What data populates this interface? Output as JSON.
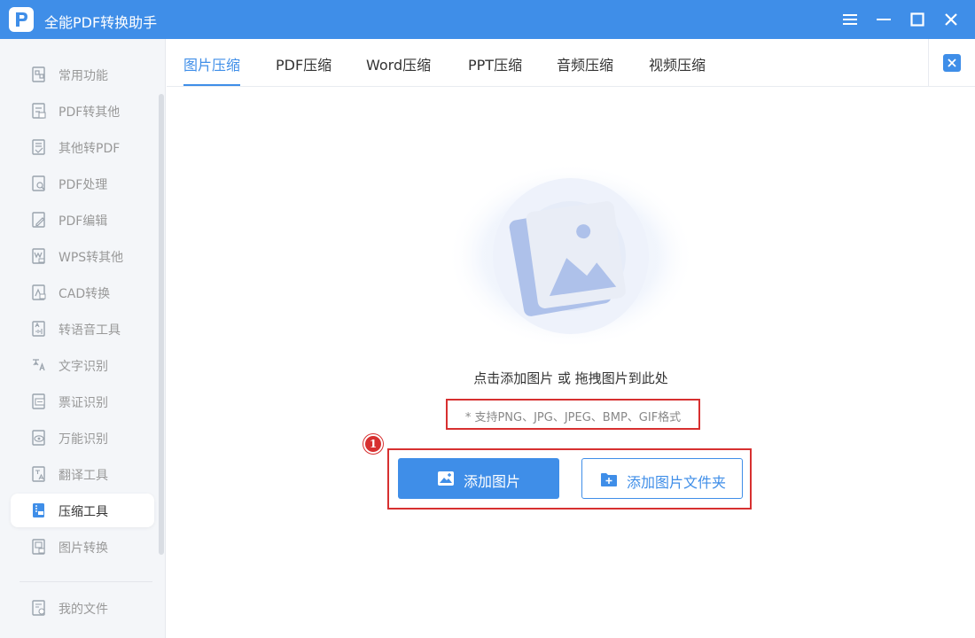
{
  "app": {
    "title": "全能PDF转换助手",
    "accent_color": "#3f8ee8",
    "window_controls": [
      "menu-icon",
      "minimize-icon",
      "maximize-icon",
      "close-icon"
    ]
  },
  "sidebar": {
    "items": [
      {
        "label": "常用功能",
        "icon": "common-functions-icon"
      },
      {
        "label": "PDF转其他",
        "icon": "pdf-convert-icon"
      },
      {
        "label": "其他转PDF",
        "icon": "to-pdf-icon"
      },
      {
        "label": "PDF处理",
        "icon": "pdf-process-icon"
      },
      {
        "label": "PDF编辑",
        "icon": "pdf-edit-icon"
      },
      {
        "label": "WPS转其他",
        "icon": "wps-convert-icon"
      },
      {
        "label": "CAD转换",
        "icon": "cad-convert-icon"
      },
      {
        "label": "转语音工具",
        "icon": "speech-icon"
      },
      {
        "label": "文字识别",
        "icon": "text-recognition-icon"
      },
      {
        "label": "票证识别",
        "icon": "ticket-recognition-icon"
      },
      {
        "label": "万能识别",
        "icon": "universal-recognition-icon"
      },
      {
        "label": "翻译工具",
        "icon": "translate-icon"
      },
      {
        "label": "压缩工具",
        "icon": "compress-icon",
        "active": true
      },
      {
        "label": "图片转换",
        "icon": "image-convert-icon"
      }
    ],
    "footer_item": {
      "label": "我的文件",
      "icon": "my-files-icon"
    }
  },
  "tabs": {
    "items": [
      {
        "label": "图片压缩",
        "active": true
      },
      {
        "label": "PDF压缩"
      },
      {
        "label": "Word压缩"
      },
      {
        "label": "PPT压缩"
      },
      {
        "label": "音频压缩"
      },
      {
        "label": "视频压缩"
      }
    ],
    "close_icon": "close-icon"
  },
  "main": {
    "drop_hint": "点击添加图片 或 拖拽图片到此处",
    "support_formats": "* 支持PNG、JPG、JPEG、BMP、GIF格式",
    "add_image_label": "添加图片",
    "add_folder_label": "添加图片文件夹",
    "step_number": "1",
    "highlight_color": "#d73030"
  }
}
